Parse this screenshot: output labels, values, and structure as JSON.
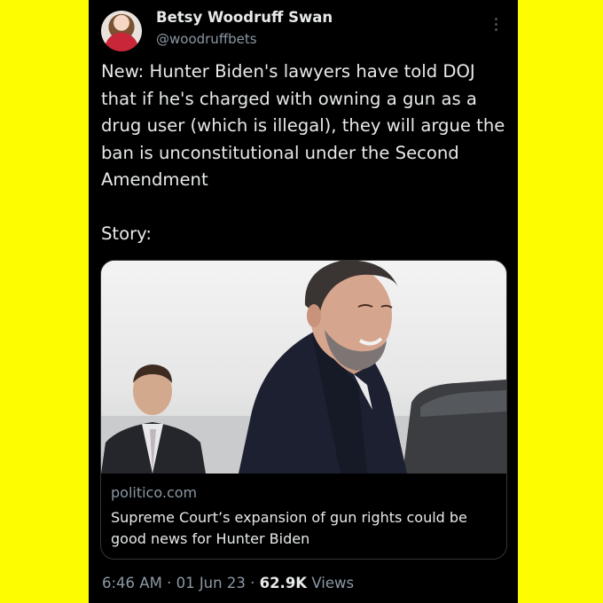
{
  "author": {
    "display_name": "Betsy Woodruff Swan",
    "handle": "@woodruffbets"
  },
  "tweet": {
    "text": "New: Hunter Biden's lawyers have told DOJ that if he's charged with owning a gun as a drug user (which is illegal), they will argue the ban is unconstitutional under the Second Amendment\n\nStory:"
  },
  "link_card": {
    "domain": "politico.com",
    "title": "Supreme Court’s expansion of gun rights could be good news for Hunter Biden"
  },
  "meta": {
    "time": "6:46 AM",
    "date": "01 Jun 23",
    "views_count": "62.9K",
    "views_label": "Views",
    "separator": " · "
  },
  "colors": {
    "background_outer": "#fdfc00",
    "tweet_bg": "#000000",
    "text_primary": "#e7e9ea",
    "text_secondary": "#8b98a5"
  },
  "icons": {
    "more": "more-options-icon"
  }
}
